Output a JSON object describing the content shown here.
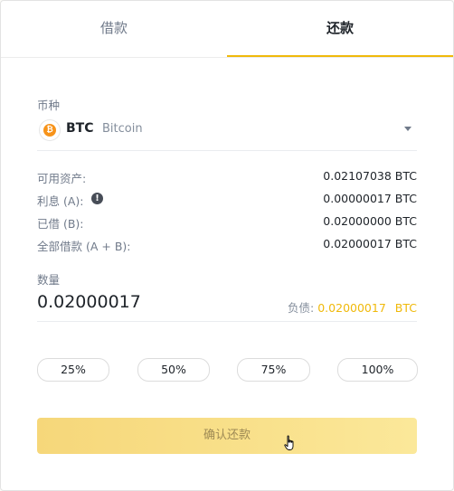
{
  "tabs": {
    "borrow": "借款",
    "repay": "还款"
  },
  "coin": {
    "label": "币种",
    "symbol": "BTC",
    "name": "Bitcoin",
    "icon": "bitcoin-icon",
    "icon_glyph": "₿"
  },
  "info": [
    {
      "key": "可用资产:",
      "value": "0.02107038 BTC"
    },
    {
      "key": "利息 (A):",
      "value": "0.00000017 BTC"
    },
    {
      "key": "已借 (B):",
      "value": "0.02000000 BTC"
    },
    {
      "key": "全部借款 (A + B):",
      "value": "0.02000017 BTC"
    }
  ],
  "amount": {
    "label": "数量",
    "value": "0.02000017",
    "debt_label": "负债:",
    "debt_value": "0.02000017",
    "debt_unit": "BTC"
  },
  "percent_buttons": [
    "25%",
    "50%",
    "75%",
    "100%"
  ],
  "confirm_label": "确认还款",
  "colors": {
    "accent": "#f0b90b",
    "bitcoin": "#f7931a"
  }
}
